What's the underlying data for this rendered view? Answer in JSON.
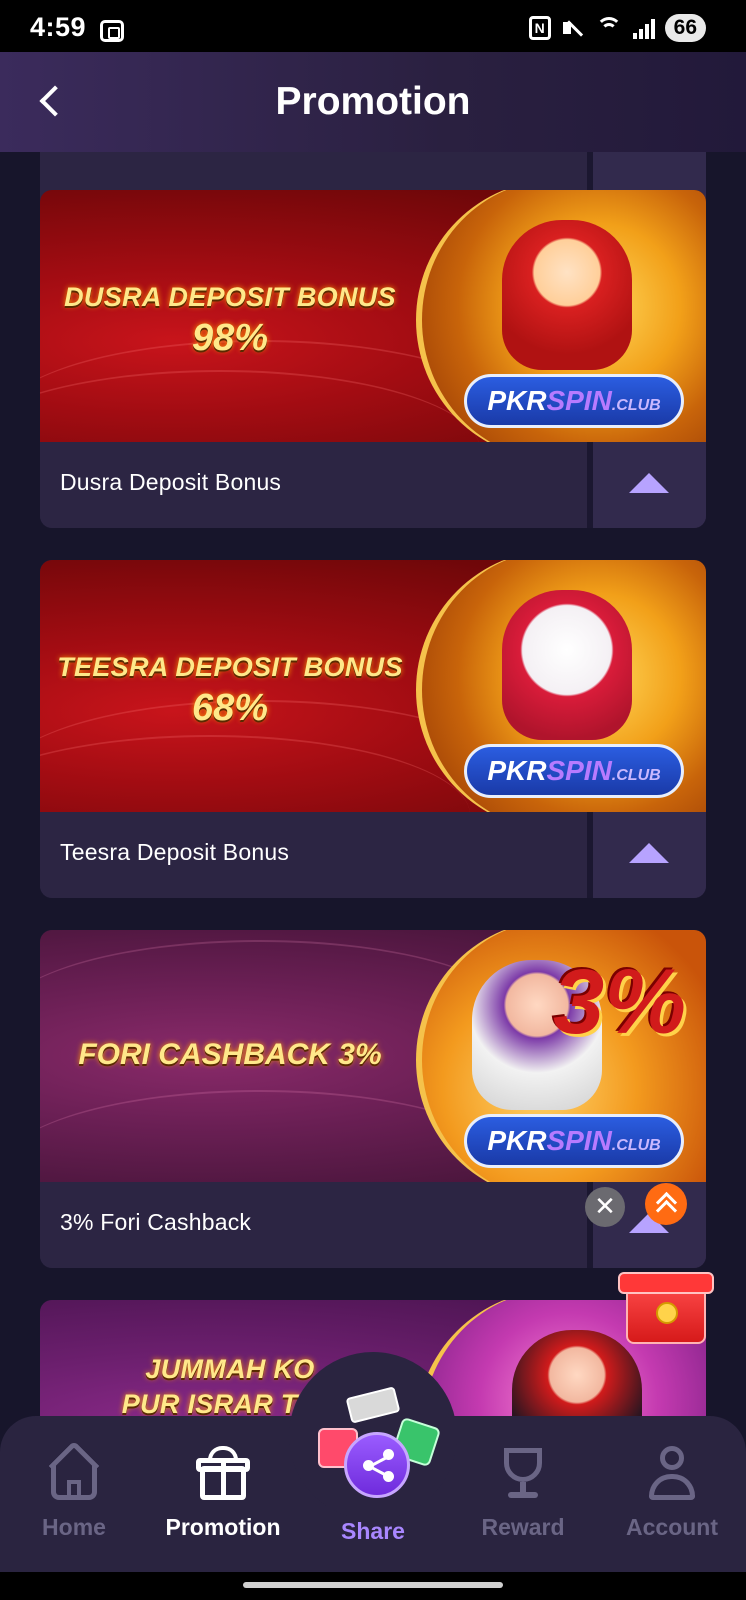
{
  "status_bar": {
    "time": "4:59",
    "nfc_label": "N",
    "battery": "66",
    "icons": [
      "screenshot-icon",
      "nfc-icon",
      "mute-icon",
      "wifi-icon",
      "signal-icon",
      "battery-icon"
    ]
  },
  "header": {
    "title": "Promotion",
    "back_icon": "chevron-left-icon"
  },
  "promotions": [
    {
      "banner_line1": "DUSRA DEPOSIT BONUS",
      "banner_line2": "98%",
      "brand_main": "PKR",
      "brand_accent": "SPIN",
      "brand_suffix": ".CLUB",
      "title": "Dusra Deposit Bonus",
      "theme": "red"
    },
    {
      "banner_line1": "TEESRA DEPOSIT BONUS",
      "banner_line2": "68%",
      "brand_main": "PKR",
      "brand_accent": "SPIN",
      "brand_suffix": ".CLUB",
      "title": "Teesra Deposit Bonus",
      "theme": "red"
    },
    {
      "banner_line1": "FORI CASHBACK 3%",
      "banner_line2": "",
      "big_percent": "3%",
      "brand_main": "PKR",
      "brand_accent": "SPIN",
      "brand_suffix": ".CLUB",
      "title": "3% Fori Cashback",
      "theme": "purple"
    },
    {
      "banner_line1": "JUMMAH KO",
      "banner_line2": "PUR ISRAR TOH",
      "theme": "purple"
    }
  ],
  "floating": {
    "close_glyph": "✕"
  },
  "bottom_nav": {
    "home": "Home",
    "promotion": "Promotion",
    "share": "Share",
    "reward": "Reward",
    "account": "Account",
    "active": "promotion"
  },
  "colors": {
    "background": "#17152b",
    "card": "#2a2342",
    "accent_purple": "#b7a3ff",
    "banner_red": "#a10c12",
    "banner_purple": "#6a1f54",
    "banner_text": "#ffe88a",
    "nav_inactive": "#6a6585",
    "share_label": "#a987ff"
  }
}
